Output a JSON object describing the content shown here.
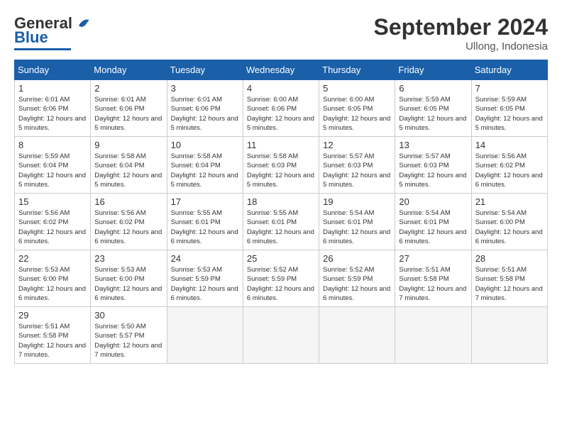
{
  "header": {
    "logo_general": "General",
    "logo_blue": "Blue",
    "month": "September 2024",
    "location": "Ullong, Indonesia"
  },
  "days_of_week": [
    "Sunday",
    "Monday",
    "Tuesday",
    "Wednesday",
    "Thursday",
    "Friday",
    "Saturday"
  ],
  "weeks": [
    [
      {
        "day": "1",
        "sunrise": "6:01 AM",
        "sunset": "6:06 PM",
        "daylight": "12 hours and 5 minutes."
      },
      {
        "day": "2",
        "sunrise": "6:01 AM",
        "sunset": "6:06 PM",
        "daylight": "12 hours and 5 minutes."
      },
      {
        "day": "3",
        "sunrise": "6:01 AM",
        "sunset": "6:06 PM",
        "daylight": "12 hours and 5 minutes."
      },
      {
        "day": "4",
        "sunrise": "6:00 AM",
        "sunset": "6:06 PM",
        "daylight": "12 hours and 5 minutes."
      },
      {
        "day": "5",
        "sunrise": "6:00 AM",
        "sunset": "6:05 PM",
        "daylight": "12 hours and 5 minutes."
      },
      {
        "day": "6",
        "sunrise": "5:59 AM",
        "sunset": "6:05 PM",
        "daylight": "12 hours and 5 minutes."
      },
      {
        "day": "7",
        "sunrise": "5:59 AM",
        "sunset": "6:05 PM",
        "daylight": "12 hours and 5 minutes."
      }
    ],
    [
      {
        "day": "8",
        "sunrise": "5:59 AM",
        "sunset": "6:04 PM",
        "daylight": "12 hours and 5 minutes."
      },
      {
        "day": "9",
        "sunrise": "5:58 AM",
        "sunset": "6:04 PM",
        "daylight": "12 hours and 5 minutes."
      },
      {
        "day": "10",
        "sunrise": "5:58 AM",
        "sunset": "6:04 PM",
        "daylight": "12 hours and 5 minutes."
      },
      {
        "day": "11",
        "sunrise": "5:58 AM",
        "sunset": "6:03 PM",
        "daylight": "12 hours and 5 minutes."
      },
      {
        "day": "12",
        "sunrise": "5:57 AM",
        "sunset": "6:03 PM",
        "daylight": "12 hours and 5 minutes."
      },
      {
        "day": "13",
        "sunrise": "5:57 AM",
        "sunset": "6:03 PM",
        "daylight": "12 hours and 5 minutes."
      },
      {
        "day": "14",
        "sunrise": "5:56 AM",
        "sunset": "6:02 PM",
        "daylight": "12 hours and 6 minutes."
      }
    ],
    [
      {
        "day": "15",
        "sunrise": "5:56 AM",
        "sunset": "6:02 PM",
        "daylight": "12 hours and 6 minutes."
      },
      {
        "day": "16",
        "sunrise": "5:56 AM",
        "sunset": "6:02 PM",
        "daylight": "12 hours and 6 minutes."
      },
      {
        "day": "17",
        "sunrise": "5:55 AM",
        "sunset": "6:01 PM",
        "daylight": "12 hours and 6 minutes."
      },
      {
        "day": "18",
        "sunrise": "5:55 AM",
        "sunset": "6:01 PM",
        "daylight": "12 hours and 6 minutes."
      },
      {
        "day": "19",
        "sunrise": "5:54 AM",
        "sunset": "6:01 PM",
        "daylight": "12 hours and 6 minutes."
      },
      {
        "day": "20",
        "sunrise": "5:54 AM",
        "sunset": "6:01 PM",
        "daylight": "12 hours and 6 minutes."
      },
      {
        "day": "21",
        "sunrise": "5:54 AM",
        "sunset": "6:00 PM",
        "daylight": "12 hours and 6 minutes."
      }
    ],
    [
      {
        "day": "22",
        "sunrise": "5:53 AM",
        "sunset": "6:00 PM",
        "daylight": "12 hours and 6 minutes."
      },
      {
        "day": "23",
        "sunrise": "5:53 AM",
        "sunset": "6:00 PM",
        "daylight": "12 hours and 6 minutes."
      },
      {
        "day": "24",
        "sunrise": "5:53 AM",
        "sunset": "5:59 PM",
        "daylight": "12 hours and 6 minutes."
      },
      {
        "day": "25",
        "sunrise": "5:52 AM",
        "sunset": "5:59 PM",
        "daylight": "12 hours and 6 minutes."
      },
      {
        "day": "26",
        "sunrise": "5:52 AM",
        "sunset": "5:59 PM",
        "daylight": "12 hours and 6 minutes."
      },
      {
        "day": "27",
        "sunrise": "5:51 AM",
        "sunset": "5:58 PM",
        "daylight": "12 hours and 7 minutes."
      },
      {
        "day": "28",
        "sunrise": "5:51 AM",
        "sunset": "5:58 PM",
        "daylight": "12 hours and 7 minutes."
      }
    ],
    [
      {
        "day": "29",
        "sunrise": "5:51 AM",
        "sunset": "5:58 PM",
        "daylight": "12 hours and 7 minutes."
      },
      {
        "day": "30",
        "sunrise": "5:50 AM",
        "sunset": "5:57 PM",
        "daylight": "12 hours and 7 minutes."
      },
      null,
      null,
      null,
      null,
      null
    ]
  ]
}
